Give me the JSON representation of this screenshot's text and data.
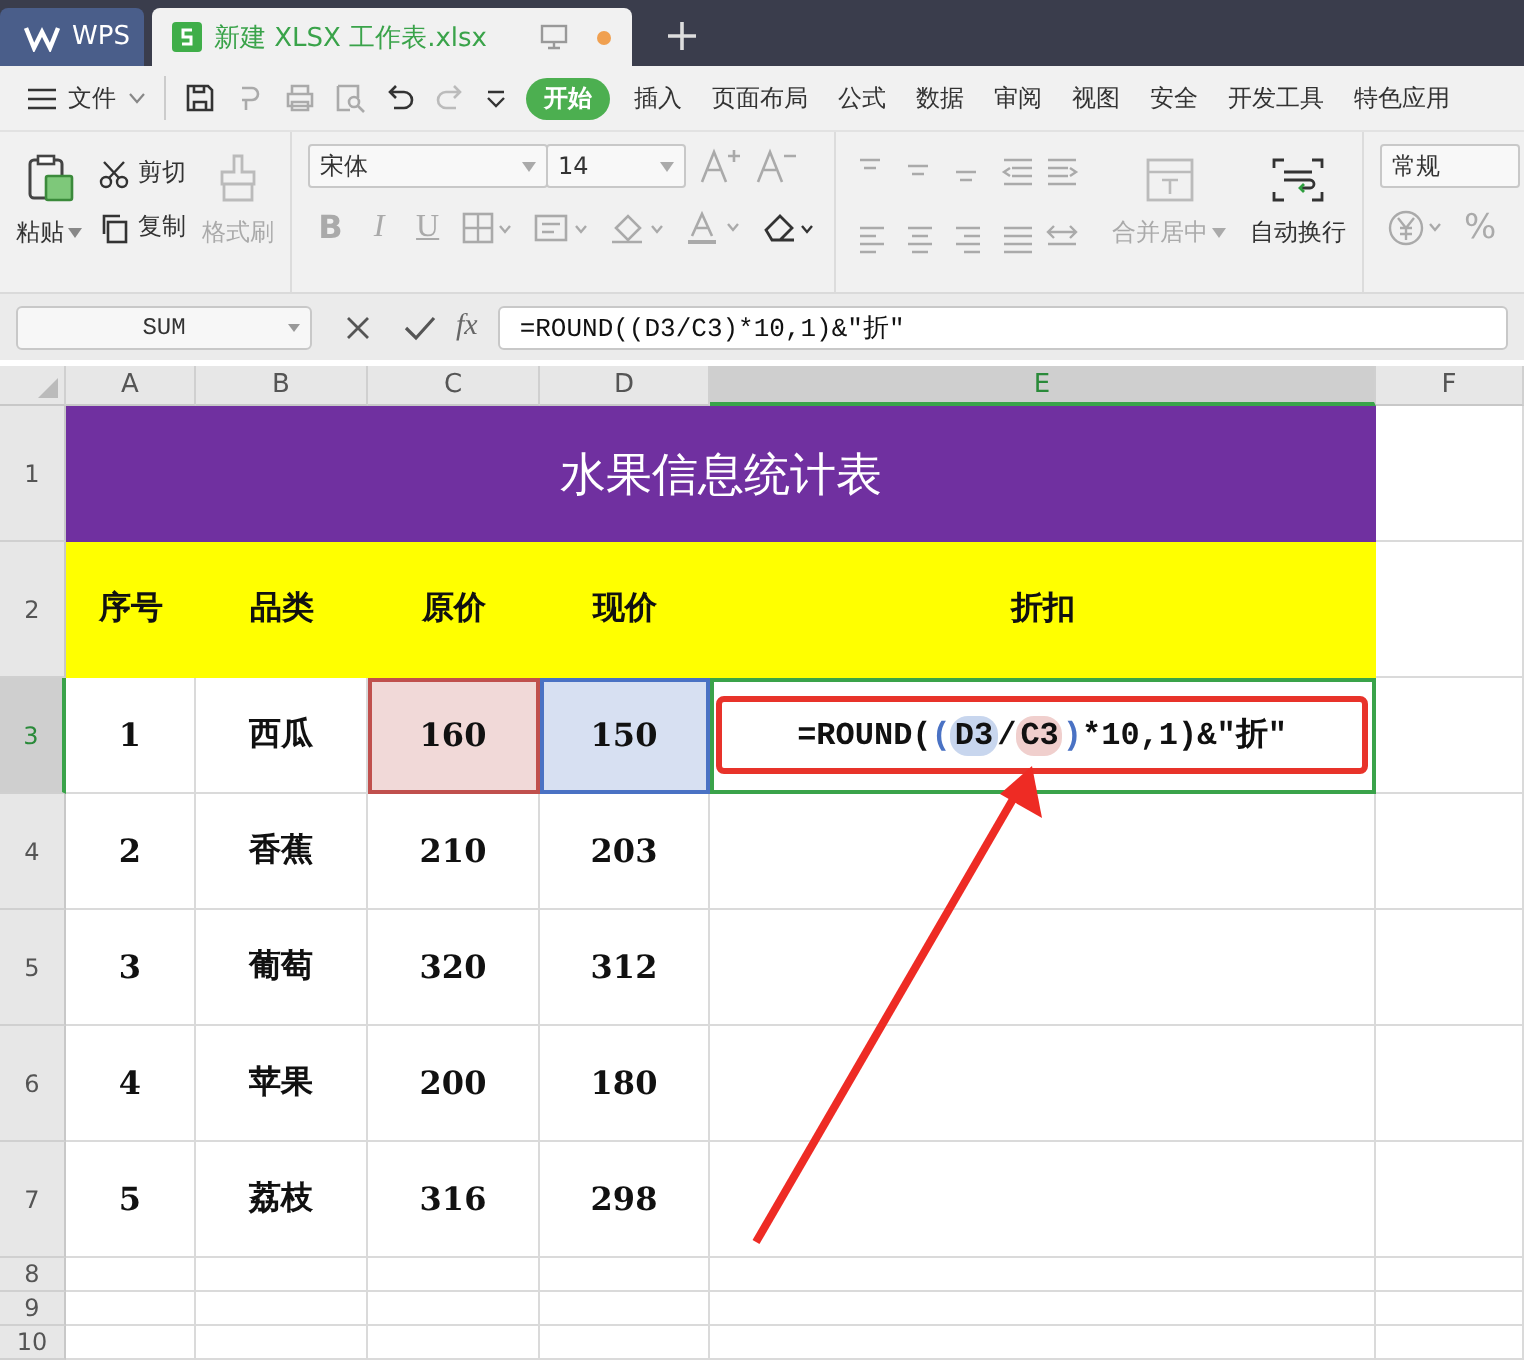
{
  "tabs": [
    {
      "label": "WPS",
      "kind": "home",
      "selected": false
    },
    {
      "label": "新建 XLSX 工作表.xlsx",
      "kind": "doc",
      "selected": true,
      "modified": true
    }
  ],
  "menu": {
    "file": "文件",
    "tabs": [
      {
        "label": "开始",
        "selected": true
      },
      {
        "label": "插入",
        "selected": false
      },
      {
        "label": "页面布局",
        "selected": false
      },
      {
        "label": "公式",
        "selected": false
      },
      {
        "label": "数据",
        "selected": false
      },
      {
        "label": "审阅",
        "selected": false
      },
      {
        "label": "视图",
        "selected": false
      },
      {
        "label": "安全",
        "selected": false
      },
      {
        "label": "开发工具",
        "selected": false
      },
      {
        "label": "特色应用",
        "selected": false
      }
    ]
  },
  "ribbon": {
    "paste": "粘贴",
    "cut": "剪切",
    "copy": "复制",
    "format_painter": {
      "label": "格式刷",
      "disabled": true
    },
    "font": "宋体",
    "size": "14",
    "styles": [
      "B",
      "I",
      "U"
    ],
    "merge": {
      "label": "合并居中",
      "disabled": true
    },
    "wrap": {
      "label": "自动换行",
      "disabled": false
    },
    "number_format": "常规",
    "percent": "%"
  },
  "formula_bar": {
    "name_box": "SUM",
    "fx": "fx",
    "formula": "=ROUND((D3/C3)*10,1)&″折″"
  },
  "sheet": {
    "columns": [
      {
        "label": "A",
        "selected": false
      },
      {
        "label": "B",
        "selected": false
      },
      {
        "label": "C",
        "selected": false
      },
      {
        "label": "D",
        "selected": false
      },
      {
        "label": "E",
        "selected": true
      },
      {
        "label": "F",
        "selected": false
      }
    ],
    "rows": [
      {
        "number": "1",
        "selected": false,
        "kind": "title",
        "text": "水果信息统计表"
      },
      {
        "number": "2",
        "selected": false,
        "kind": "header",
        "cells": [
          "序号",
          "品类",
          "原价",
          "现价",
          "折扣"
        ]
      },
      {
        "number": "3",
        "selected": true,
        "kind": "data",
        "cells": [
          {
            "text": "1"
          },
          {
            "text": "西瓜"
          },
          {
            "text": "160",
            "color": "#c0504d"
          },
          {
            "text": "150",
            "color": "#4a72c4"
          }
        ],
        "formula": [
          {
            "text": "=ROUND(",
            "kind": "plain"
          },
          {
            "text": "(",
            "kind": "paren",
            "color": "#4a72c4"
          },
          {
            "text": "D3",
            "kind": "ref",
            "color": "#c8d6ee"
          },
          {
            "text": "/",
            "kind": "plain"
          },
          {
            "text": "C3",
            "kind": "ref",
            "color": "#f0cfcd"
          },
          {
            "text": ")",
            "kind": "paren",
            "color": "#4a72c4"
          },
          {
            "text": "*10,1)&″折″",
            "kind": "plain"
          }
        ]
      },
      {
        "number": "4",
        "selected": false,
        "kind": "data",
        "cells": [
          {
            "text": "2"
          },
          {
            "text": "香蕉"
          },
          {
            "text": "210"
          },
          {
            "text": "203"
          }
        ]
      },
      {
        "number": "5",
        "selected": false,
        "kind": "data",
        "cells": [
          {
            "text": "3"
          },
          {
            "text": "葡萄"
          },
          {
            "text": "320"
          },
          {
            "text": "312"
          }
        ]
      },
      {
        "number": "6",
        "selected": false,
        "kind": "data",
        "cells": [
          {
            "text": "4"
          },
          {
            "text": "苹果"
          },
          {
            "text": "200"
          },
          {
            "text": "180"
          }
        ]
      },
      {
        "number": "7",
        "selected": false,
        "kind": "data",
        "cells": [
          {
            "text": "5"
          },
          {
            "text": "荔枝"
          },
          {
            "text": "316"
          },
          {
            "text": "298"
          }
        ]
      },
      {
        "number": "8",
        "selected": false,
        "kind": "empty"
      },
      {
        "number": "9",
        "selected": false,
        "kind": "empty"
      },
      {
        "number": "10",
        "selected": false,
        "kind": "empty"
      }
    ]
  }
}
